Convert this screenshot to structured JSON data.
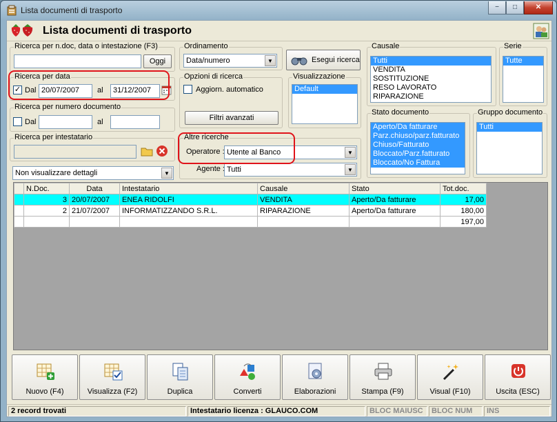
{
  "window": {
    "title": "Lista documenti di trasporto",
    "minimize": "−",
    "maximize": "□",
    "close": "✕"
  },
  "header": {
    "title": "Lista documenti di trasporto",
    "left_icon": "strawberries-icon",
    "right_icon": "users-icon"
  },
  "search_text": {
    "legend": "Ricerca per n.doc, data o intestazione (F3)",
    "value": "",
    "button": "Oggi"
  },
  "date_search": {
    "legend": "Ricerca per data",
    "checked": "✓",
    "from_label": "Dal",
    "from": "20/07/2007",
    "to_label": "al",
    "to": "31/12/2007"
  },
  "number_search": {
    "legend": "Ricerca per numero documento",
    "checked": "",
    "from_label": "Dal",
    "from": "",
    "to_label": "al",
    "to": ""
  },
  "holder_search": {
    "legend": "Ricerca per intestatario",
    "value": ""
  },
  "details_select": {
    "value": "Non visualizzare dettagli"
  },
  "ordering": {
    "legend": "Ordinamento",
    "value": "Data/numero"
  },
  "search_button": {
    "label": "Esegui ricerca",
    "icon": "binoculars-icon"
  },
  "search_options": {
    "legend": "Opzioni di ricerca",
    "checkbox_label": "Aggiorn. automatico",
    "checked": "",
    "advanced_button": "Filtri avanzati"
  },
  "display": {
    "legend": "Visualizzazione",
    "items": [
      "Default"
    ]
  },
  "other_search": {
    "legend": "Altre ricerche",
    "operator_label": "Operatore :",
    "operator_value": "Utente al Banco",
    "agent_label": "Agente :",
    "agent_value": "Tutti"
  },
  "causale": {
    "legend": "Causale",
    "items": [
      "Tutti",
      "VENDITA",
      "SOSTITUZIONE",
      "RESO LAVORATO",
      "RIPARAZIONE"
    ]
  },
  "serie": {
    "legend": "Serie",
    "items": [
      "Tutte"
    ]
  },
  "stato": {
    "legend": "Stato documento",
    "items": [
      "Aperto/Da fatturare",
      "Parz.chiuso/parz.fatturato",
      "Chiuso/Fatturato",
      "Bloccato/Parz.fatturato",
      "Bloccato/No Fattura"
    ]
  },
  "gruppo": {
    "legend": "Gruppo documento",
    "items": [
      "Tutti"
    ]
  },
  "table": {
    "columns": [
      "N.Doc.",
      "Data",
      "Intestatario",
      "Causale",
      "Stato",
      "Tot.doc."
    ],
    "rows": [
      {
        "ndoc": "3",
        "data": "20/07/2007",
        "intestatario": "ENEA RIDOLFI",
        "causale": "VENDITA",
        "stato": "Aperto/Da fatturare",
        "totale": "17,00"
      },
      {
        "ndoc": "2",
        "data": "21/07/2007",
        "intestatario": "INFORMATIZZANDO S.R.L.",
        "causale": "RIPARAZIONE",
        "stato": "Aperto/Da fatturare",
        "totale": "180,00"
      }
    ],
    "grand_total": "197,00"
  },
  "toolbar": [
    {
      "label": "Nuovo (F4)",
      "icon": "new-document-icon"
    },
    {
      "label": "Visualizza (F2)",
      "icon": "view-checklist-icon"
    },
    {
      "label": "Duplica",
      "icon": "duplicate-icon"
    },
    {
      "label": "Converti",
      "icon": "convert-shapes-icon"
    },
    {
      "label": "Elaborazioni",
      "icon": "gear-document-icon"
    },
    {
      "label": "Stampa (F9)",
      "icon": "printer-icon"
    },
    {
      "label": "Visual (F10)",
      "icon": "magic-wand-icon"
    },
    {
      "label": "Uscita (ESC)",
      "icon": "power-icon"
    }
  ],
  "status": {
    "records": "2 record trovati",
    "license": "Intestatario licenza : GLAUCO.COM",
    "caps": "BLOC MAIUSC",
    "num": "BLOC NUM",
    "ins": "INS"
  },
  "colors": {
    "selection": "#3399ff",
    "highlight_row": "#00ffff",
    "annotation": "#e0131a"
  }
}
